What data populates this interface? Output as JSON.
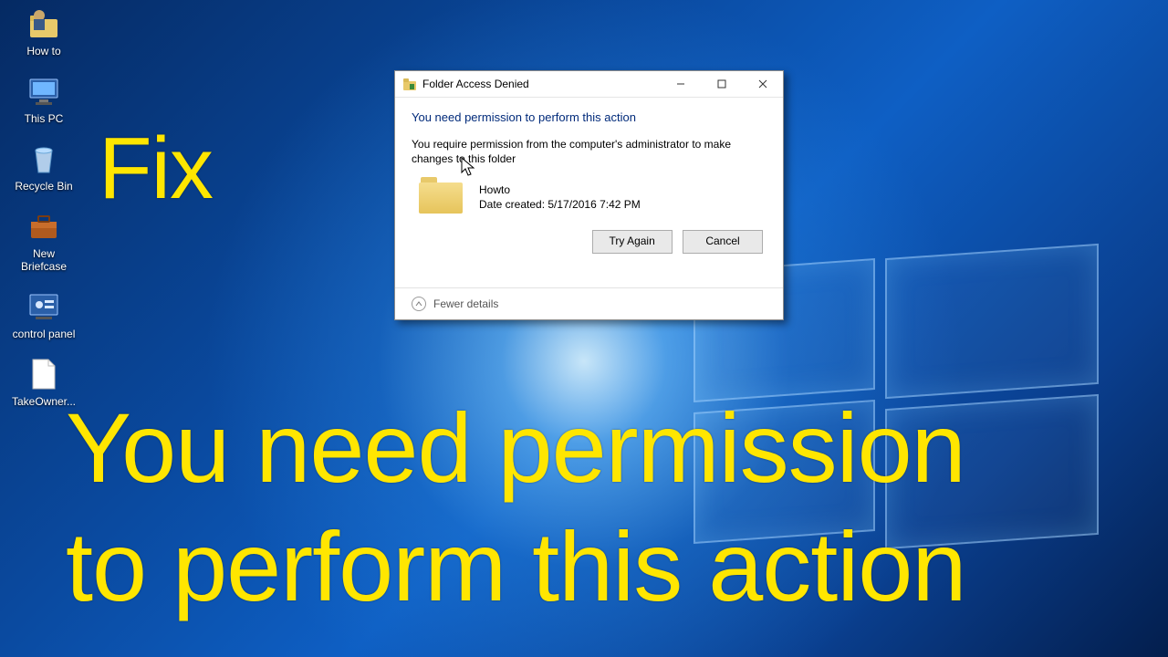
{
  "desktop_icons": [
    {
      "name": "howto",
      "label": "How to"
    },
    {
      "name": "thispc",
      "label": "This PC"
    },
    {
      "name": "recycle",
      "label": "Recycle Bin"
    },
    {
      "name": "briefcase",
      "label": "New\nBriefcase"
    },
    {
      "name": "cpanel",
      "label": "control panel"
    },
    {
      "name": "takeown",
      "label": "TakeOwner..."
    }
  ],
  "overlay": {
    "line1": "Fix",
    "line2": "You need permission",
    "line3": "to perform this action"
  },
  "dialog": {
    "title": "Folder Access Denied",
    "heading": "You need permission to perform this action",
    "message": "You require permission from the computer's administrator to make changes to this folder",
    "folder_name": "Howto",
    "folder_date": "Date created: 5/17/2016 7:42 PM",
    "btn_try": "Try Again",
    "btn_cancel": "Cancel",
    "fewer": "Fewer details"
  }
}
